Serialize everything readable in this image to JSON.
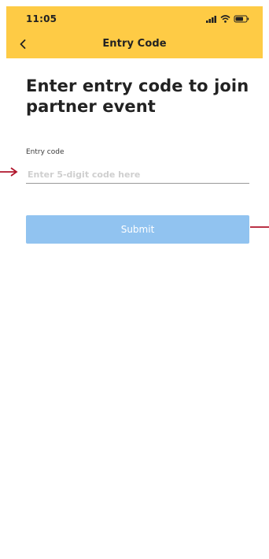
{
  "status_bar": {
    "time": "11:05",
    "icons": [
      "signal-icon",
      "wifi-icon",
      "battery-icon"
    ]
  },
  "nav": {
    "title": "Entry Code",
    "back_icon": "chevron-left-icon"
  },
  "page": {
    "heading": "Enter entry code to join partner event"
  },
  "form": {
    "label": "Entry code",
    "input_value": "",
    "input_placeholder": "Enter 5-digit code here",
    "submit_label": "Submit"
  },
  "colors": {
    "header_bg": "#fecb45",
    "submit_bg": "#91c3f0",
    "annotation_arrow": "#b0152b"
  }
}
